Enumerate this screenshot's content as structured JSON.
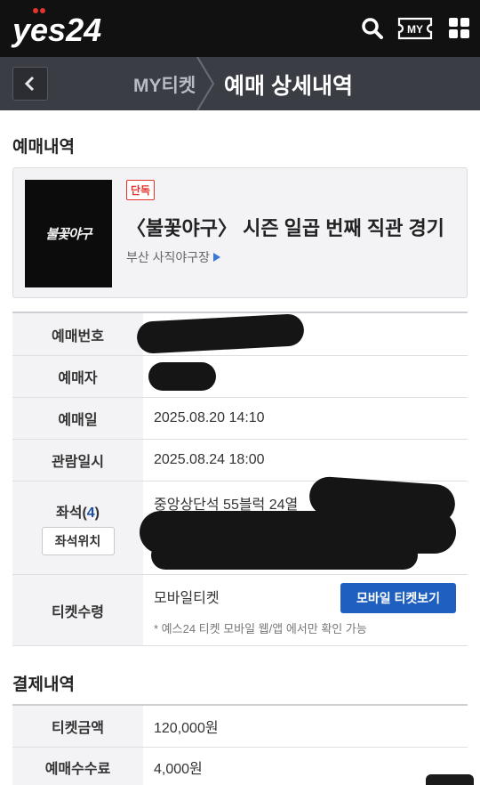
{
  "header": {
    "logo_text": "yes24",
    "my_label": "MY"
  },
  "subheader": {
    "parent": "MY티켓",
    "current": "예매 상세내역"
  },
  "booking_section": {
    "title": "예매내역",
    "event": {
      "poster_text": "불꽃야구",
      "badge": "단독",
      "title": "〈불꽃야구〉 시즌 일곱 번째 직관 경기",
      "venue": "부산 사직야구장"
    },
    "rows": {
      "booking_number_label": "예매번호",
      "booker_label": "예매자",
      "booking_date_label": "예매일",
      "booking_date_value": "2025.08.20 14:10",
      "view_datetime_label": "관람일시",
      "view_datetime_value": "2025.08.24 18:00",
      "seat_label": "좌석",
      "seat_count": "4",
      "seat_position_button": "좌석위치",
      "seat_value": "중앙상단석 55블럭 24열",
      "ticket_receipt_label": "티켓수령",
      "ticket_receipt_value": "모바일티켓",
      "mobile_ticket_button": "모바일 티켓보기",
      "mobile_note": "* 예스24 티켓 모바일 웹/앱 에서만 확인 가능"
    }
  },
  "payment_section": {
    "title": "결제내역",
    "ticket_amount_label": "티켓금액",
    "ticket_amount_value": "120,000원",
    "booking_fee_label": "예매수수료",
    "booking_fee_value": "4,000원"
  },
  "colors": {
    "topbar": "#111111",
    "subheader": "#3b3d45",
    "accent_blue": "#1e5fbf",
    "badge_red": "#e2342c"
  },
  "icons": [
    "logo",
    "search-icon",
    "my-ticket-icon",
    "grid-menu-icon",
    "back-arrow-icon",
    "chevron-right-icon",
    "triangle-right-icon"
  ]
}
